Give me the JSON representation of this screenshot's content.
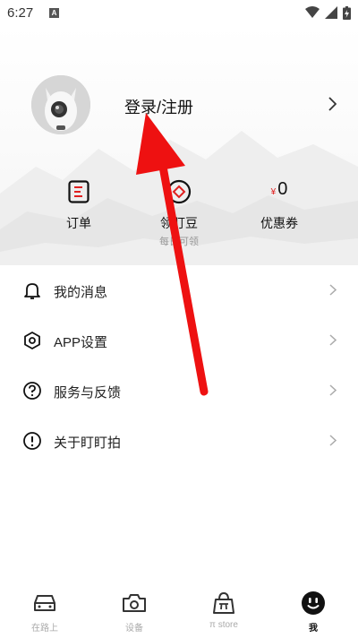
{
  "status_bar": {
    "time": "6:27",
    "notif_letter": "A"
  },
  "profile": {
    "login_label": "登录/注册"
  },
  "quick_actions": {
    "orders": {
      "label": "订单"
    },
    "beans": {
      "label": "领盯豆",
      "sub": "每日可领"
    },
    "coupons": {
      "currency": "¥",
      "count": "0",
      "label": "优惠券"
    }
  },
  "menu": {
    "items": [
      {
        "label": "我的消息",
        "icon": "bell-icon"
      },
      {
        "label": "APP设置",
        "icon": "hexagon-settings-icon"
      },
      {
        "label": "服务与反馈",
        "icon": "question-circle-icon"
      },
      {
        "label": "关于盯盯拍",
        "icon": "info-circle-icon"
      }
    ]
  },
  "bottom_nav": {
    "items": [
      {
        "label": "在路上",
        "icon": "car-icon"
      },
      {
        "label": "设备",
        "icon": "camera-icon"
      },
      {
        "label": "π store",
        "icon": "bag-icon"
      },
      {
        "label": "我",
        "icon": "smiley-icon"
      }
    ],
    "active_index": 3
  },
  "colors": {
    "accent_red": "#e02020",
    "annotation_red": "#ee1111"
  }
}
